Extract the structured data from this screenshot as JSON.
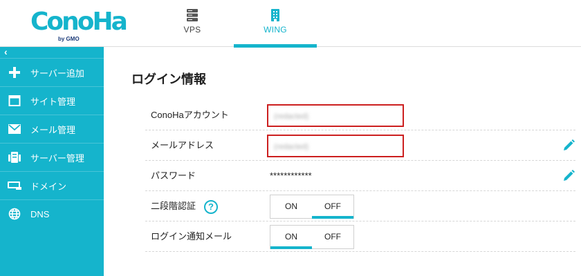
{
  "logo": {
    "text": "ConoHa",
    "sub": "by GMO"
  },
  "tabs": [
    {
      "label": "VPS",
      "icon": "server-icon"
    },
    {
      "label": "WING",
      "icon": "building-icon",
      "active": true
    }
  ],
  "sidebar": {
    "collapse": "‹",
    "items": [
      {
        "label": "サーバー追加",
        "icon": "plus-icon"
      },
      {
        "label": "サイト管理",
        "icon": "window-icon"
      },
      {
        "label": "メール管理",
        "icon": "mail-icon"
      },
      {
        "label": "サーバー管理",
        "icon": "server-manage-icon"
      },
      {
        "label": "ドメイン",
        "icon": "domain-icon"
      },
      {
        "label": "DNS",
        "icon": "globe-icon"
      }
    ]
  },
  "main": {
    "title": "ログイン情報",
    "rows": {
      "account": {
        "label": "ConoHaアカウント",
        "value": "(redacted)"
      },
      "email": {
        "label": "メールアドレス",
        "value": "(redacted)"
      },
      "password": {
        "label": "パスワード",
        "value": "************"
      },
      "two_factor": {
        "label": "二段階認証",
        "help": "?",
        "on": "ON",
        "off": "OFF",
        "selected": "OFF"
      },
      "login_notice": {
        "label": "ログイン通知メール",
        "on": "ON",
        "off": "OFF",
        "selected": "ON"
      }
    }
  },
  "colors": {
    "accent": "#15b4cc",
    "highlight_box": "#cc1f1f"
  }
}
